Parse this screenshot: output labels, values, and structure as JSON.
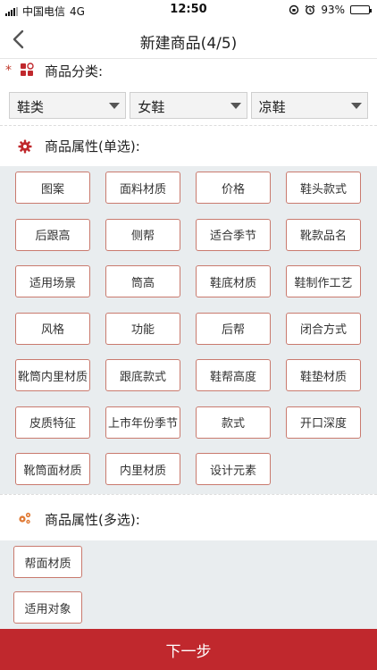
{
  "status_bar": {
    "carrier": "中国电信",
    "network": "4G",
    "time": "12:50",
    "battery": "93%"
  },
  "nav": {
    "title": "新建商品(4/5)",
    "back_icon": "chevron-left-icon"
  },
  "category": {
    "required_mark": "*",
    "label": "商品分类:",
    "selects": [
      {
        "value": "鞋类"
      },
      {
        "value": "女鞋"
      },
      {
        "value": "凉鞋"
      }
    ]
  },
  "single_attrs": {
    "label": "商品属性(单选):",
    "tags": [
      "图案",
      "面料材质",
      "价格",
      "鞋头款式",
      "后跟高",
      "侧帮",
      "适合季节",
      "靴款品名",
      "适用场景",
      "筒高",
      "鞋底材质",
      "鞋制作工艺",
      "风格",
      "功能",
      "后帮",
      "闭合方式",
      "靴筒内里材质",
      "跟底款式",
      "鞋帮高度",
      "鞋垫材质",
      "皮质特征",
      "上市年份季节",
      "款式",
      "开口深度",
      "靴筒面材质",
      "内里材质",
      "设计元素"
    ]
  },
  "multi_attrs": {
    "label": "商品属性(多选):",
    "tags": [
      "帮面材质",
      "适用对象"
    ]
  },
  "footer": {
    "next_label": "下一步"
  },
  "colors": {
    "accent": "#c0282d",
    "tag_border": "#c97a6e",
    "panel_bg": "#e9edef"
  }
}
